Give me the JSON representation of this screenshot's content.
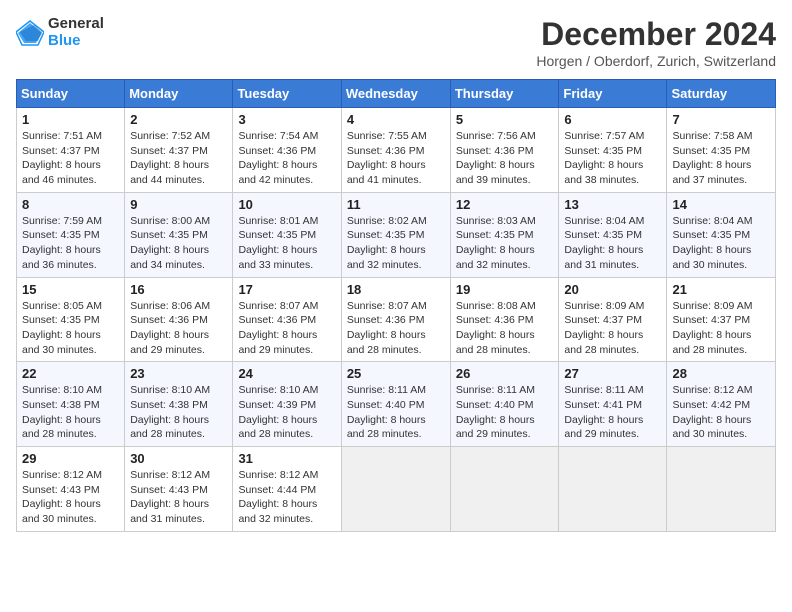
{
  "logo": {
    "general": "General",
    "blue": "Blue"
  },
  "title": {
    "month": "December 2024",
    "location": "Horgen / Oberdorf, Zurich, Switzerland"
  },
  "headers": [
    "Sunday",
    "Monday",
    "Tuesday",
    "Wednesday",
    "Thursday",
    "Friday",
    "Saturday"
  ],
  "weeks": [
    [
      {
        "day": "1",
        "sunrise": "7:51 AM",
        "sunset": "4:37 PM",
        "daylight": "8 hours and 46 minutes."
      },
      {
        "day": "2",
        "sunrise": "7:52 AM",
        "sunset": "4:37 PM",
        "daylight": "8 hours and 44 minutes."
      },
      {
        "day": "3",
        "sunrise": "7:54 AM",
        "sunset": "4:36 PM",
        "daylight": "8 hours and 42 minutes."
      },
      {
        "day": "4",
        "sunrise": "7:55 AM",
        "sunset": "4:36 PM",
        "daylight": "8 hours and 41 minutes."
      },
      {
        "day": "5",
        "sunrise": "7:56 AM",
        "sunset": "4:36 PM",
        "daylight": "8 hours and 39 minutes."
      },
      {
        "day": "6",
        "sunrise": "7:57 AM",
        "sunset": "4:35 PM",
        "daylight": "8 hours and 38 minutes."
      },
      {
        "day": "7",
        "sunrise": "7:58 AM",
        "sunset": "4:35 PM",
        "daylight": "8 hours and 37 minutes."
      }
    ],
    [
      {
        "day": "8",
        "sunrise": "7:59 AM",
        "sunset": "4:35 PM",
        "daylight": "8 hours and 36 minutes."
      },
      {
        "day": "9",
        "sunrise": "8:00 AM",
        "sunset": "4:35 PM",
        "daylight": "8 hours and 34 minutes."
      },
      {
        "day": "10",
        "sunrise": "8:01 AM",
        "sunset": "4:35 PM",
        "daylight": "8 hours and 33 minutes."
      },
      {
        "day": "11",
        "sunrise": "8:02 AM",
        "sunset": "4:35 PM",
        "daylight": "8 hours and 32 minutes."
      },
      {
        "day": "12",
        "sunrise": "8:03 AM",
        "sunset": "4:35 PM",
        "daylight": "8 hours and 32 minutes."
      },
      {
        "day": "13",
        "sunrise": "8:04 AM",
        "sunset": "4:35 PM",
        "daylight": "8 hours and 31 minutes."
      },
      {
        "day": "14",
        "sunrise": "8:04 AM",
        "sunset": "4:35 PM",
        "daylight": "8 hours and 30 minutes."
      }
    ],
    [
      {
        "day": "15",
        "sunrise": "8:05 AM",
        "sunset": "4:35 PM",
        "daylight": "8 hours and 30 minutes."
      },
      {
        "day": "16",
        "sunrise": "8:06 AM",
        "sunset": "4:36 PM",
        "daylight": "8 hours and 29 minutes."
      },
      {
        "day": "17",
        "sunrise": "8:07 AM",
        "sunset": "4:36 PM",
        "daylight": "8 hours and 29 minutes."
      },
      {
        "day": "18",
        "sunrise": "8:07 AM",
        "sunset": "4:36 PM",
        "daylight": "8 hours and 28 minutes."
      },
      {
        "day": "19",
        "sunrise": "8:08 AM",
        "sunset": "4:36 PM",
        "daylight": "8 hours and 28 minutes."
      },
      {
        "day": "20",
        "sunrise": "8:09 AM",
        "sunset": "4:37 PM",
        "daylight": "8 hours and 28 minutes."
      },
      {
        "day": "21",
        "sunrise": "8:09 AM",
        "sunset": "4:37 PM",
        "daylight": "8 hours and 28 minutes."
      }
    ],
    [
      {
        "day": "22",
        "sunrise": "8:10 AM",
        "sunset": "4:38 PM",
        "daylight": "8 hours and 28 minutes."
      },
      {
        "day": "23",
        "sunrise": "8:10 AM",
        "sunset": "4:38 PM",
        "daylight": "8 hours and 28 minutes."
      },
      {
        "day": "24",
        "sunrise": "8:10 AM",
        "sunset": "4:39 PM",
        "daylight": "8 hours and 28 minutes."
      },
      {
        "day": "25",
        "sunrise": "8:11 AM",
        "sunset": "4:40 PM",
        "daylight": "8 hours and 28 minutes."
      },
      {
        "day": "26",
        "sunrise": "8:11 AM",
        "sunset": "4:40 PM",
        "daylight": "8 hours and 29 minutes."
      },
      {
        "day": "27",
        "sunrise": "8:11 AM",
        "sunset": "4:41 PM",
        "daylight": "8 hours and 29 minutes."
      },
      {
        "day": "28",
        "sunrise": "8:12 AM",
        "sunset": "4:42 PM",
        "daylight": "8 hours and 30 minutes."
      }
    ],
    [
      {
        "day": "29",
        "sunrise": "8:12 AM",
        "sunset": "4:43 PM",
        "daylight": "8 hours and 30 minutes."
      },
      {
        "day": "30",
        "sunrise": "8:12 AM",
        "sunset": "4:43 PM",
        "daylight": "8 hours and 31 minutes."
      },
      {
        "day": "31",
        "sunrise": "8:12 AM",
        "sunset": "4:44 PM",
        "daylight": "8 hours and 32 minutes."
      },
      null,
      null,
      null,
      null
    ]
  ],
  "labels": {
    "sunrise": "Sunrise:",
    "sunset": "Sunset:",
    "daylight": "Daylight:"
  }
}
